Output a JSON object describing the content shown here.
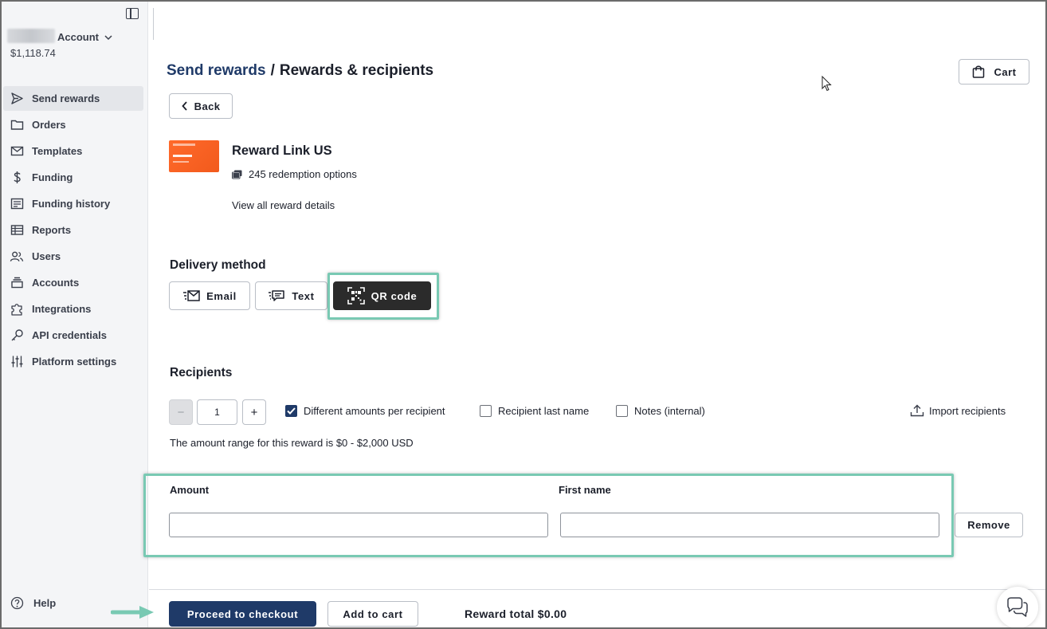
{
  "sidebar": {
    "account_label": "Account",
    "balance": "$1,118.74",
    "items": [
      {
        "label": "Send rewards",
        "icon": "send-icon",
        "active": true
      },
      {
        "label": "Orders",
        "icon": "folder-icon"
      },
      {
        "label": "Templates",
        "icon": "envelope-icon"
      },
      {
        "label": "Funding",
        "icon": "dollar-icon"
      },
      {
        "label": "Funding history",
        "icon": "receipt-icon"
      },
      {
        "label": "Reports",
        "icon": "table-icon"
      },
      {
        "label": "Users",
        "icon": "users-icon"
      },
      {
        "label": "Accounts",
        "icon": "stack-icon"
      },
      {
        "label": "Integrations",
        "icon": "puzzle-icon"
      },
      {
        "label": "API credentials",
        "icon": "key-icon"
      },
      {
        "label": "Platform settings",
        "icon": "sliders-icon"
      }
    ],
    "help_label": "Help"
  },
  "header": {
    "breadcrumb_link": "Send rewards",
    "breadcrumb_separator": "/",
    "breadcrumb_current": "Rewards & recipients",
    "cart_label": "Cart",
    "back_label": "Back"
  },
  "reward": {
    "title": "Reward Link US",
    "redemption_options": "245 redemption options",
    "view_details": "View all reward details"
  },
  "delivery": {
    "title": "Delivery method",
    "options": [
      {
        "label": "Email",
        "icon": "email-icon"
      },
      {
        "label": "Text",
        "icon": "sms-icon"
      },
      {
        "label": "QR code",
        "icon": "qr-code-icon",
        "selected": true
      }
    ]
  },
  "recipients": {
    "title": "Recipients",
    "count": "1",
    "minus": "−",
    "plus": "+",
    "options": [
      {
        "label": "Different amounts per recipient",
        "checked": true
      },
      {
        "label": "Recipient last name",
        "checked": false
      },
      {
        "label": "Notes (internal)",
        "checked": false
      }
    ],
    "import_label": "Import recipients",
    "range_text": "The amount range for this reward is $0 - $2,000 USD",
    "amount_label": "Amount",
    "first_name_label": "First name",
    "amount_value": "",
    "first_name_value": "",
    "remove_label": "Remove"
  },
  "footer": {
    "checkout_label": "Proceed to checkout",
    "add_to_cart_label": "Add to cart",
    "reward_total": "Reward total $0.00"
  },
  "colors": {
    "primary": "#1f3a68",
    "highlight": "#79c9b3",
    "reward_orange": "#f25a1c",
    "selected_dark": "#2b2b2b"
  }
}
